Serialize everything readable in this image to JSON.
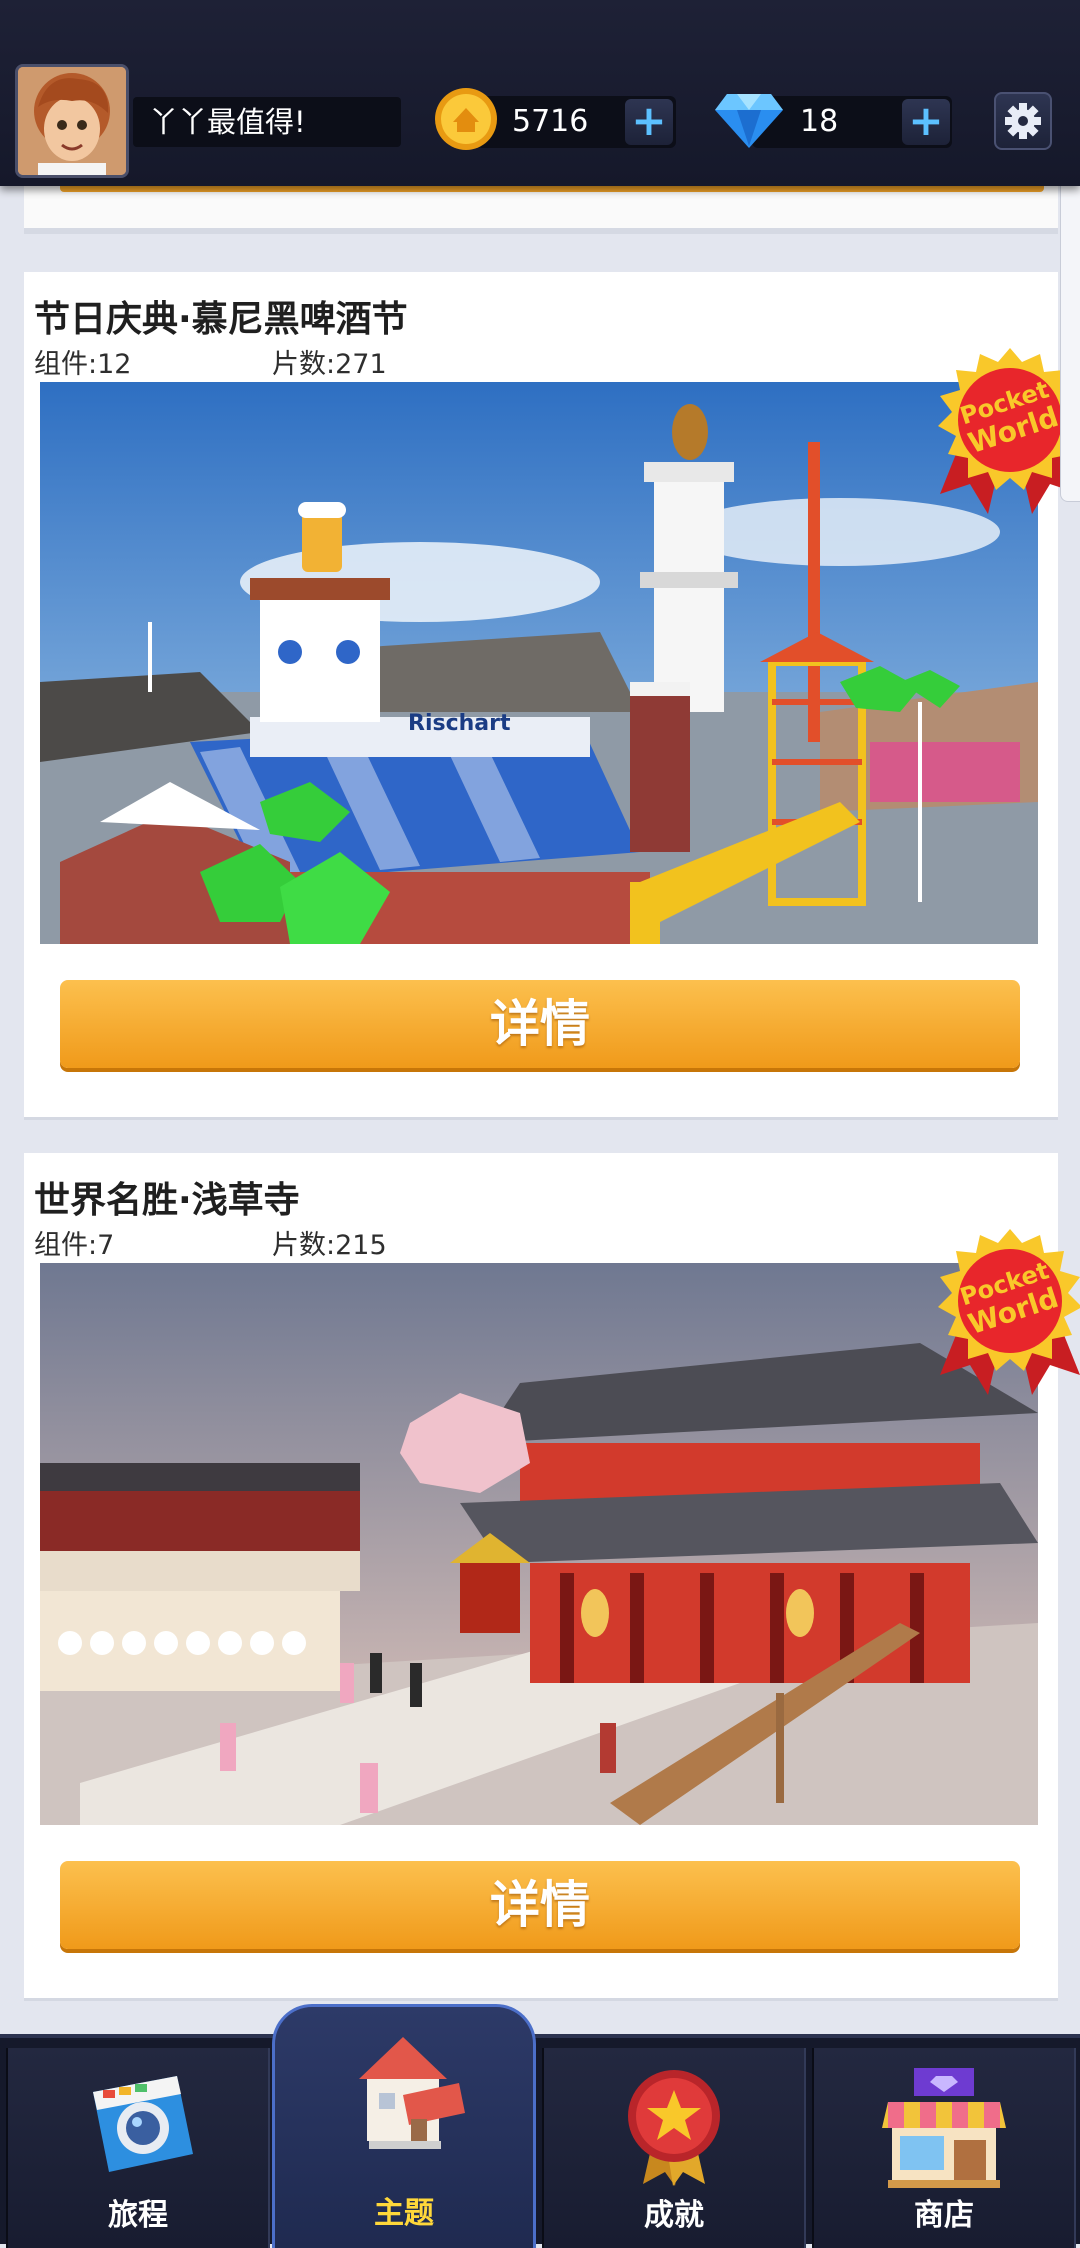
{
  "header": {
    "username": "丫丫最值得!",
    "coins": "5716",
    "gems": "18",
    "plus_symbol": "+"
  },
  "themes": [
    {
      "title": "节日庆典·慕尼黑啤酒节",
      "components": "组件:12",
      "pieces": "片数:271",
      "badge_line1": "Pocket",
      "badge_line2": "World",
      "sign_text": "Rischart",
      "details_label": "详情"
    },
    {
      "title": "世界名胜·浅草寺",
      "components": "组件:7",
      "pieces": "片数:215",
      "badge_line1": "Pocket",
      "badge_line2": "World",
      "details_label": "详情"
    }
  ],
  "nav": [
    {
      "label": "旅程",
      "icon": "camera-icon"
    },
    {
      "label": "主题",
      "icon": "house-icon"
    },
    {
      "label": "成就",
      "icon": "medal-icon"
    },
    {
      "label": "商店",
      "icon": "shop-icon"
    }
  ],
  "colors": {
    "accent_orange": "#f5a623",
    "nav_active_label": "#ffd83a",
    "badge_red": "#e8262b",
    "badge_gold": "#f9c82a"
  }
}
